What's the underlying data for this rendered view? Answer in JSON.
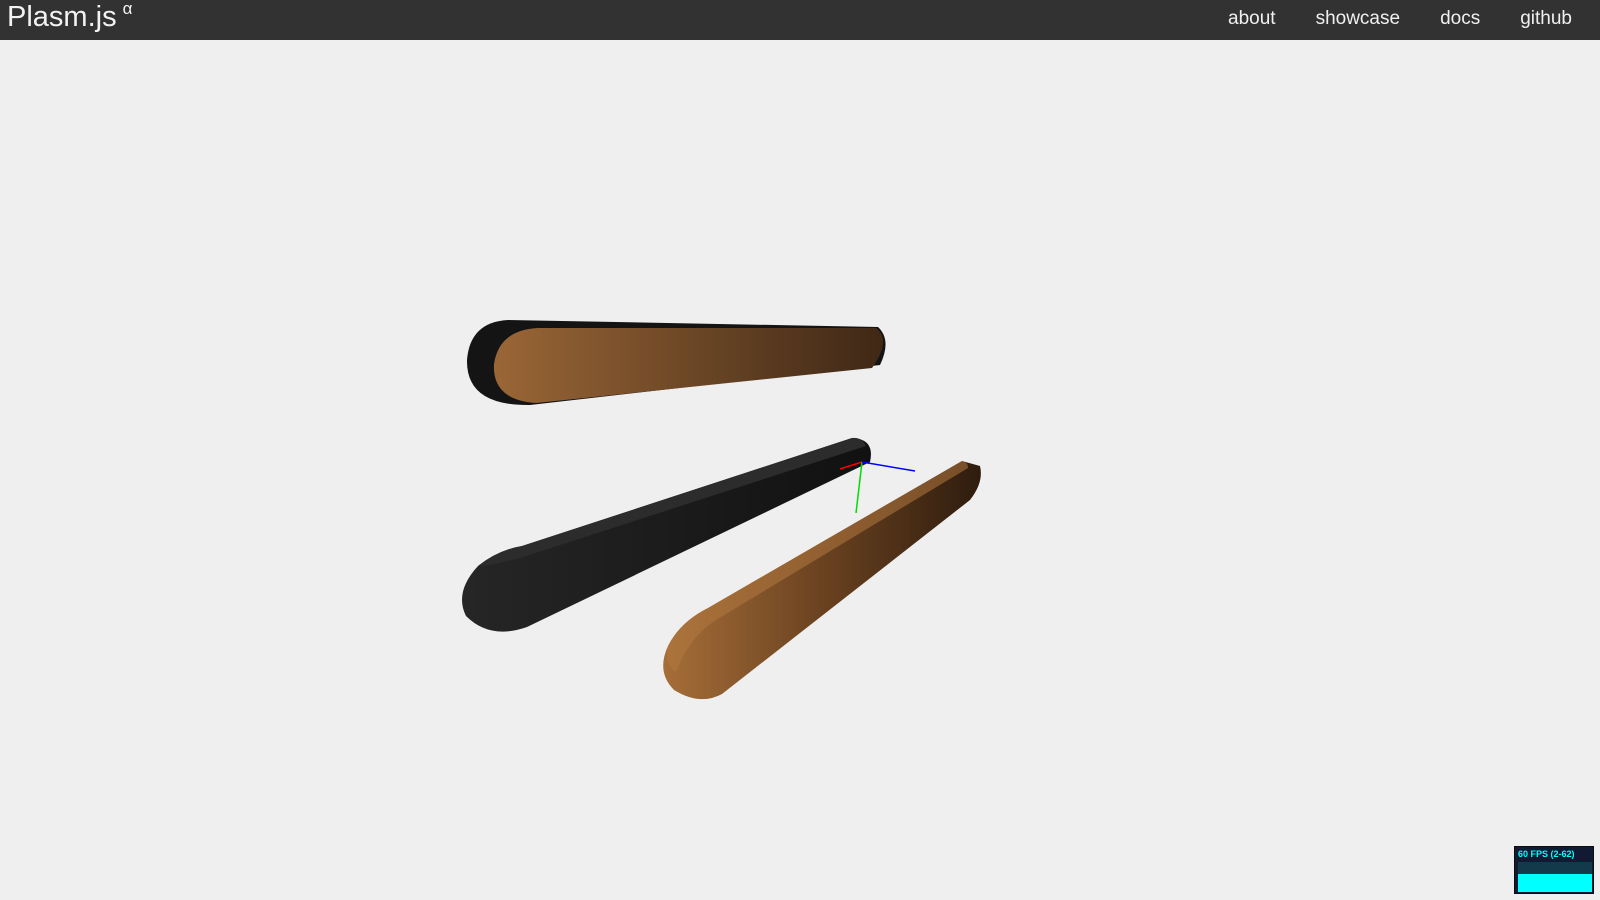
{
  "app": {
    "brand": "Plasm.js",
    "brand_sup": "α"
  },
  "nav": {
    "items": [
      {
        "label": "about"
      },
      {
        "label": "showcase"
      },
      {
        "label": "docs"
      },
      {
        "label": "github"
      }
    ]
  },
  "scene": {
    "colors": {
      "background": "#efefef",
      "wood_light": "#9a6636",
      "wood_dark": "#3d2614",
      "black_part": "#1c1c1c",
      "axis_x": "#ff0000",
      "axis_y": "#00dd00",
      "axis_z": "#0000ff"
    }
  },
  "fps_meter": {
    "label": "60 FPS (2-62)",
    "fill_level": 0.6
  }
}
